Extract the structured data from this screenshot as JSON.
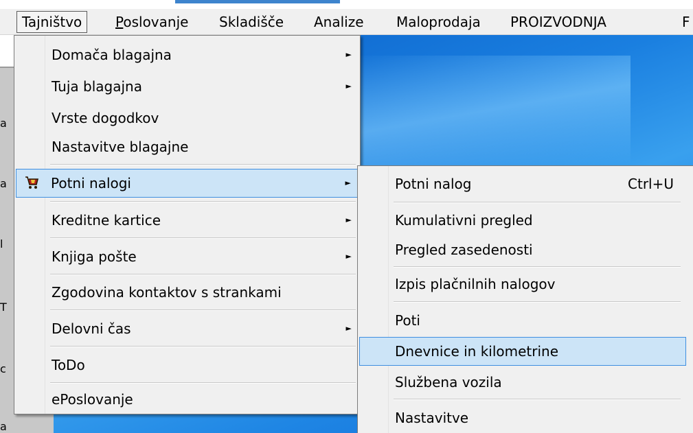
{
  "menubar": {
    "items": [
      {
        "label": "Tajništvo"
      },
      {
        "label": "Poslovanje",
        "mnemonic": "P",
        "rest": "oslovanje"
      },
      {
        "label": "Skladišče"
      },
      {
        "label": "Analize"
      },
      {
        "label": "Maloprodaja"
      },
      {
        "label": "PROIZVODNJA"
      },
      {
        "label": "F"
      }
    ]
  },
  "edge_chars": [
    "a",
    "a",
    "l",
    "T",
    "c",
    "a"
  ],
  "main_menu": {
    "items": [
      {
        "label": "Domača blagajna",
        "submenu": true
      },
      {
        "label": "Tuja blagajna",
        "submenu": true
      },
      {
        "label": "Vrste dogodkov"
      },
      {
        "label": "Nastavitve blagajne"
      },
      {
        "label": "Potni nalogi",
        "submenu": true,
        "icon": "cart-icon"
      },
      {
        "label": "Kreditne kartice",
        "submenu": true
      },
      {
        "label": "Knjiga pošte",
        "submenu": true
      },
      {
        "label": "Zgodovina kontaktov s strankami"
      },
      {
        "label": "Delovni čas",
        "submenu": true
      },
      {
        "label": "ToDo"
      },
      {
        "label": "ePoslovanje"
      }
    ],
    "arrow_glyph": "►"
  },
  "sub_menu": {
    "items": [
      {
        "label": "Potni nalog",
        "shortcut": "Ctrl+U"
      },
      {
        "label": "Kumulativni pregled"
      },
      {
        "label": "Pregled zasedenosti"
      },
      {
        "label": "Izpis plačnilnih nalogov"
      },
      {
        "label": "Poti"
      },
      {
        "label": "Dnevnice in kilometrine"
      },
      {
        "label": "Službena vozila"
      },
      {
        "label": "Nastavitve"
      }
    ]
  },
  "colors": {
    "highlight": "#cce4f7",
    "highlight_border": "#3d8ee0",
    "menu_bg": "#f0f0f0",
    "desktop": "#1a7fe0"
  }
}
